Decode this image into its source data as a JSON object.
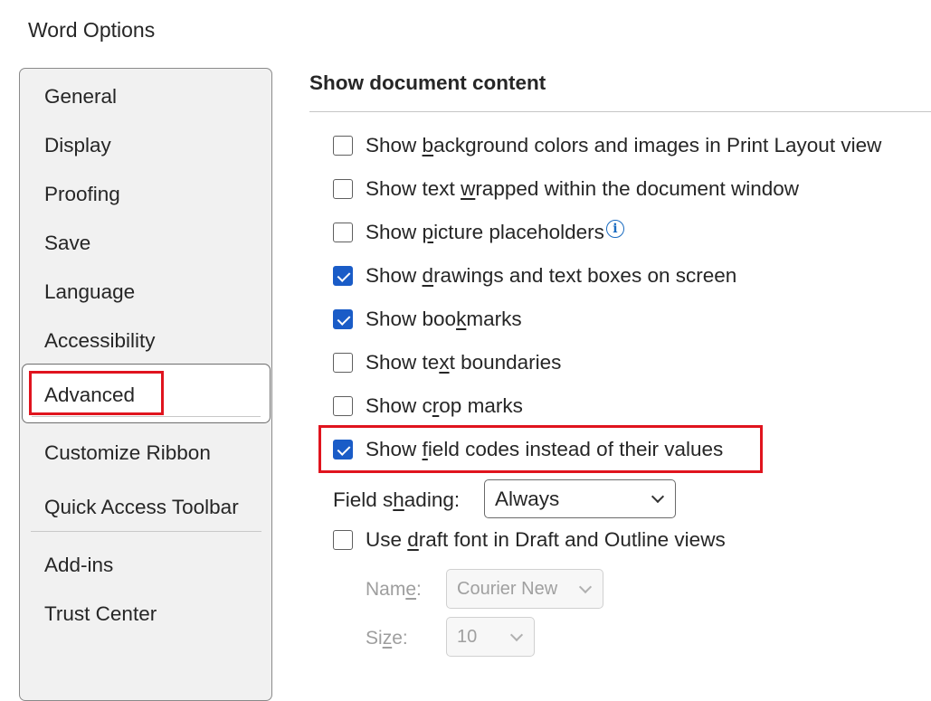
{
  "window": {
    "title": "Word Options"
  },
  "sidebar": {
    "items": [
      {
        "label": "General"
      },
      {
        "label": "Display"
      },
      {
        "label": "Proofing"
      },
      {
        "label": "Save"
      },
      {
        "label": "Language"
      },
      {
        "label": "Accessibility"
      },
      {
        "label": "Advanced",
        "selected": true
      },
      {
        "label": "Customize Ribbon"
      },
      {
        "label": "Quick Access Toolbar"
      },
      {
        "label": "Add-ins"
      },
      {
        "label": "Trust Center"
      }
    ]
  },
  "section": {
    "title": "Show document content"
  },
  "options": [
    {
      "pre": "Show ",
      "key": "b",
      "post": "ackground colors and images in Print Layout view",
      "checked": false
    },
    {
      "pre": "Show text ",
      "key": "w",
      "post": "rapped within the document window",
      "checked": false
    },
    {
      "pre": "Show ",
      "key": "p",
      "post": "icture placeholders",
      "checked": false
    },
    {
      "pre": "Show ",
      "key": "d",
      "post": "rawings and text boxes on screen",
      "checked": true
    },
    {
      "pre": "Show boo",
      "key": "k",
      "post": "marks",
      "checked": true
    },
    {
      "pre": "Show te",
      "key": "x",
      "post": "t boundaries",
      "checked": false
    },
    {
      "pre": "Show c",
      "key": "r",
      "post": "op marks",
      "checked": false
    },
    {
      "pre": "Show ",
      "key": "f",
      "post": "ield codes instead of their values",
      "checked": true
    },
    {
      "pre": "Use ",
      "key": "d",
      "post": "raft font in Draft and Outline views",
      "checked": false
    }
  ],
  "field_shading": {
    "pre": "Field s",
    "key": "h",
    "post": "ading:",
    "value": "Always"
  },
  "draft_font": {
    "name_label": {
      "pre": "Nam",
      "key": "e",
      "post": ":"
    },
    "name_value": "Courier New",
    "size_label": {
      "pre": "Si",
      "key": "z",
      "post": "e:"
    },
    "size_value": "10"
  },
  "info_icon_glyph": "i",
  "colors": {
    "accent": "#1a5cc7",
    "highlight": "#e0141e"
  }
}
